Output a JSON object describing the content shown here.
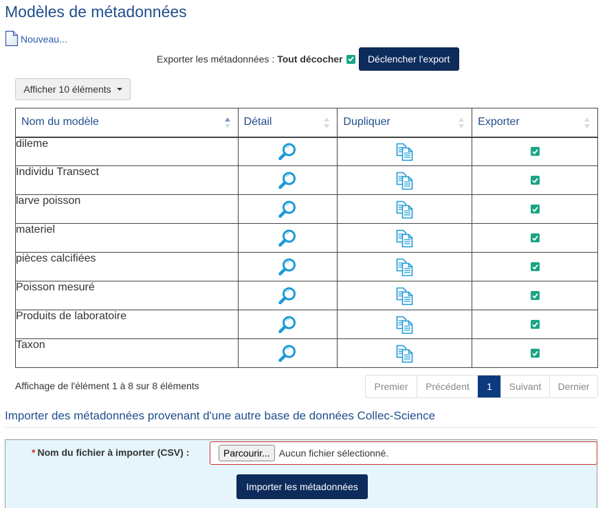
{
  "page": {
    "title": "Modèles de métadonnées",
    "new_label": "Nouveau..."
  },
  "export": {
    "label": "Exporter les métadonnées :",
    "toggle_all": "Tout décocher",
    "checked": true,
    "button": "Déclencher l'export"
  },
  "table": {
    "length_label": "Afficher 10 éléments",
    "columns": [
      "Nom du modèle",
      "Détail",
      "Dupliquer",
      "Exporter"
    ],
    "rows": [
      {
        "name": "dileme",
        "export": true
      },
      {
        "name": "Individu Transect",
        "export": true
      },
      {
        "name": "larve poisson",
        "export": true
      },
      {
        "name": "materiel",
        "export": true
      },
      {
        "name": "pièces calcifiées",
        "export": true
      },
      {
        "name": "Poisson mesuré",
        "export": true
      },
      {
        "name": "Produits de laboratoire",
        "export": true
      },
      {
        "name": "Taxon",
        "export": true
      }
    ],
    "info": "Affichage de l'élément 1 à 8 sur 8 éléments",
    "pagination": {
      "first": "Premier",
      "previous": "Précédent",
      "current": "1",
      "next": "Suivant",
      "last": "Dernier"
    }
  },
  "import": {
    "heading": "Importer des métadonnées provenant d'une autre base de données Collec-Science",
    "required_marker": "*",
    "file_label": "Nom du fichier à importer (CSV) :",
    "browse_button": "Parcourir...",
    "no_file": "Aucun fichier sélectionné.",
    "submit": "Importer les métadonnées"
  },
  "colors": {
    "primary": "#0d2c5c",
    "link": "#1f4e8c",
    "checkbox": "#1aa583",
    "icon": "#1a9ad6",
    "panel_bg": "#e6f5fb"
  },
  "icons": {
    "detail": "magnifier-icon",
    "duplicate": "copy-icon",
    "new": "document-icon"
  }
}
